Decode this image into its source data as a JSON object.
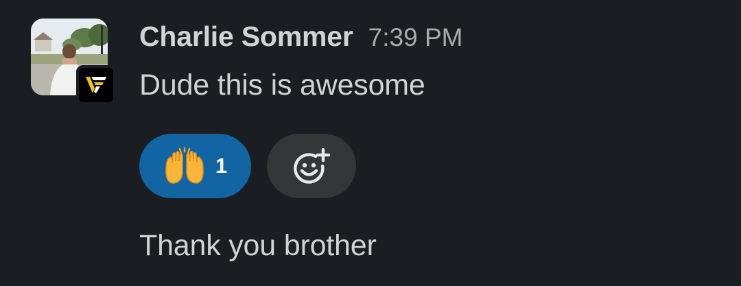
{
  "message": {
    "author": "Charlie Sommer",
    "timestamp": "7:39 PM",
    "text": "Dude this is awesome",
    "avatar_icon": "user-photo",
    "org_badge_icon": "vf-logo-badge",
    "reactions": [
      {
        "emoji_icon": "raising-hands-emoji",
        "count": "1",
        "selected": true,
        "color": "#1264a3"
      }
    ],
    "add_reaction_icon": "add-emoji-icon"
  },
  "reply": {
    "text": "Thank you brother"
  },
  "colors": {
    "background": "#1a1d21",
    "text": "#d1d2d3",
    "muted": "#ababad",
    "reaction_selected": "#1264a3",
    "reaction_button": "#343638",
    "badge_accent": "#f2c40f"
  }
}
